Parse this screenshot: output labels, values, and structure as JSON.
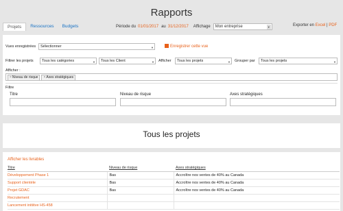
{
  "page_title": "Rapports",
  "tabs": [
    {
      "label": "Projets"
    },
    {
      "label": "Ressources"
    },
    {
      "label": "Budgets"
    }
  ],
  "period": {
    "label": "Période du",
    "from": "01/01/2017",
    "to_label": "au",
    "to": "31/12/2017"
  },
  "display": {
    "label": "Affichage",
    "value": "Mon entreprise"
  },
  "export": {
    "label": "Exporter en",
    "excel": "Excel",
    "sep": "|",
    "pdf": "PDF"
  },
  "filters": {
    "saved_views_label": "Vues enregistrées",
    "saved_views_value": "Sélectionner",
    "save_view_label": "Enregistrer cette vue",
    "filter_projects_label": "Filtrer les projets",
    "categories_value": "Tous les catégories",
    "clients_value": "Tous les Client",
    "show_label": "Afficher",
    "show_value": "Tous les projets",
    "group_label": "Grouper par",
    "group_value": "Tous les projets",
    "display_label": "Afficher :",
    "chips": [
      {
        "label": "Niveau de risque"
      },
      {
        "label": "Axes stratégiques"
      }
    ],
    "filter_label": "Filtre",
    "col_title": "Titre",
    "col_risk": "Niveau de risque",
    "col_axes": "Axes stratégiques"
  },
  "section_title": "Tous les projets",
  "show_deliverables": "Afficher les livrables",
  "table": {
    "headers": [
      "Titre",
      "Niveau de risque",
      "Axes stratégiques"
    ],
    "rows": [
      {
        "title": "Développement Phase 1",
        "risk": "Bas",
        "axes": "Accroître nos ventes de 40% au Canada"
      },
      {
        "title": "Support clientèle",
        "risk": "Bas",
        "axes": "Accroître nos ventes de 40% au Canada"
      },
      {
        "title": "Projet GDAC",
        "risk": "Bas",
        "axes": "Accroître nos ventes de 40% au Canada"
      },
      {
        "title": "Recrutement",
        "risk": "",
        "axes": ""
      },
      {
        "title": "Lancement initiitve HS-458",
        "risk": "",
        "axes": ""
      }
    ]
  },
  "colors": {
    "accent": "#e8611a",
    "link": "#1a73c4"
  }
}
